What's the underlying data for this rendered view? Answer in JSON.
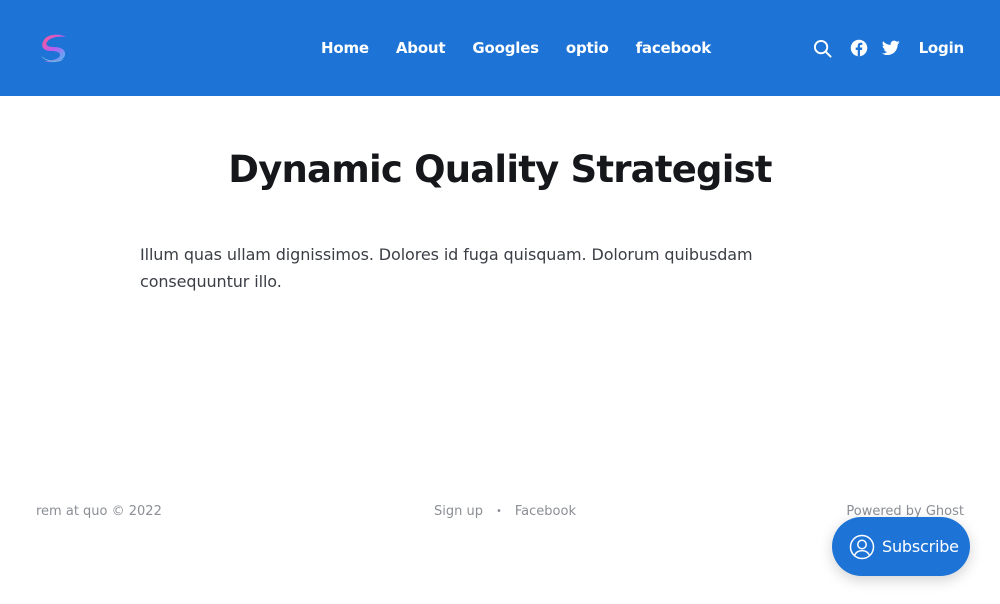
{
  "colors": {
    "brand": "#1e74d6",
    "header_text": "#ffffff",
    "footer_text": "#8b8f95"
  },
  "header": {
    "logo": "site-logo-icon",
    "nav": [
      {
        "label": "Home"
      },
      {
        "label": "About"
      },
      {
        "label": "Googles"
      },
      {
        "label": "optio"
      },
      {
        "label": "facebook"
      }
    ],
    "actions": {
      "search_icon": "search-icon",
      "facebook_icon": "facebook-icon",
      "twitter_icon": "twitter-icon",
      "login_label": "Login"
    }
  },
  "page": {
    "title": "Dynamic Quality Strategist",
    "body": "Illum quas ullam dignissimos. Dolores id fuga quisquam. Dolorum quibusdam consequuntur illo."
  },
  "footer": {
    "copyright": "rem at quo © 2022",
    "links": [
      {
        "label": "Sign up"
      },
      {
        "label": "Facebook"
      }
    ],
    "separator": "•",
    "powered_by": "Powered by Ghost"
  },
  "portal": {
    "subscribe_label": "Subscribe",
    "icon": "user-circle-icon"
  }
}
